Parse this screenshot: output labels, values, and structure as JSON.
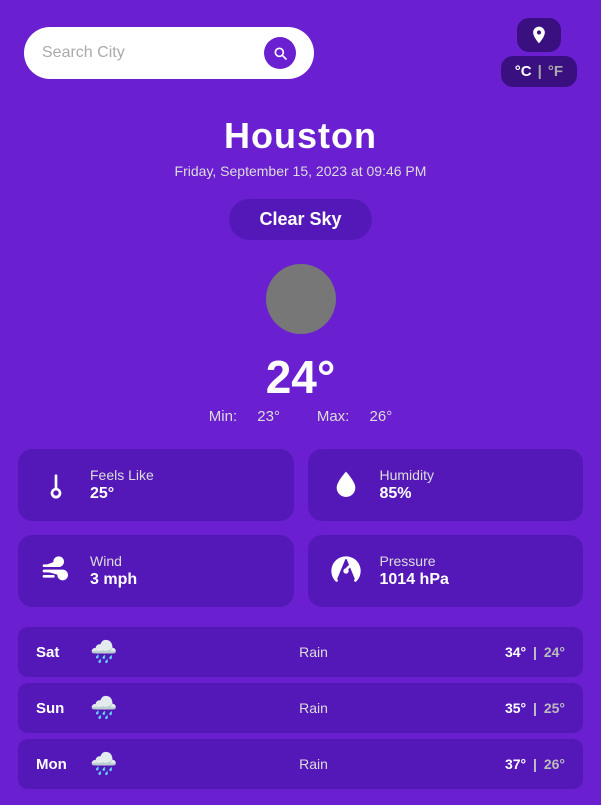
{
  "header": {
    "search_placeholder": "Search City",
    "unit_c": "°C",
    "unit_sep": "|",
    "unit_f": "°F"
  },
  "city": {
    "name": "Houston",
    "datetime": "Friday, September 15, 2023 at 09:46 PM",
    "condition": "Clear Sky"
  },
  "temperature": {
    "current": "24°",
    "min_label": "Min:",
    "min": "23°",
    "max_label": "Max:",
    "max": "26°"
  },
  "details": [
    {
      "label": "Feels Like",
      "value": "25°",
      "icon": "thermometer"
    },
    {
      "label": "Humidity",
      "value": "85%",
      "icon": "droplet"
    },
    {
      "label": "Wind",
      "value": "3 mph",
      "icon": "wind"
    },
    {
      "label": "Pressure",
      "value": "1014 hPa",
      "icon": "gauge"
    }
  ],
  "forecast": [
    {
      "day": "Sat",
      "icon": "🌧️",
      "condition": "Rain",
      "hi": "34°",
      "lo": "24°"
    },
    {
      "day": "Sun",
      "icon": "🌧️",
      "condition": "Rain",
      "hi": "35°",
      "lo": "25°"
    },
    {
      "day": "Mon",
      "icon": "🌧️",
      "condition": "Rain",
      "hi": "37°",
      "lo": "26°"
    }
  ]
}
